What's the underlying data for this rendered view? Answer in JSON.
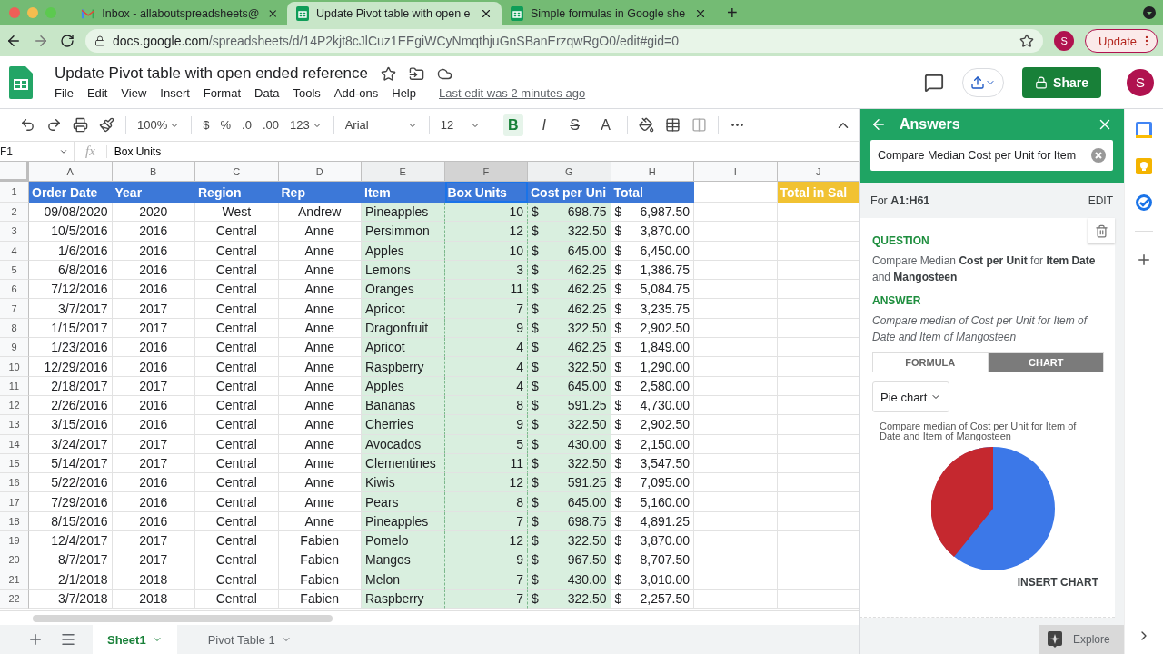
{
  "browser": {
    "tabs": [
      {
        "title": "Inbox - allaboutspreadsheets@",
        "kind": "mail",
        "selected": false
      },
      {
        "title": "Update Pivot table with open e",
        "kind": "sheets",
        "selected": true
      },
      {
        "title": "Simple formulas in Google she",
        "kind": "sheets",
        "selected": false
      }
    ],
    "new_tab": "+",
    "url_domain": "docs.google.com",
    "url_path": "/spreadsheets/d/14P2kjt8cJlCuz1EEgiWCyNmqthjuGnSBanErzqwRgO0/edit#gid=0",
    "profile": "S",
    "update_button": "Update"
  },
  "document": {
    "title": "Update Pivot table with open ended reference",
    "menu": [
      "File",
      "Edit",
      "View",
      "Insert",
      "Format",
      "Data",
      "Tools",
      "Add-ons",
      "Help"
    ],
    "last_edit": "Last edit was 2 minutes ago",
    "share": "Share",
    "avatar": "S"
  },
  "toolbar": {
    "zoom": "100%",
    "format_buttons": [
      "$",
      "%",
      ".0",
      ".00",
      "123"
    ],
    "font": "Arial",
    "font_size": "12",
    "style_buttons": [
      {
        "label": "B",
        "kind": "bold",
        "selected": true
      },
      {
        "label": "I",
        "kind": "italic",
        "selected": false
      },
      {
        "label": "S",
        "kind": "strike",
        "selected": false
      },
      {
        "label": "A",
        "kind": "color",
        "selected": false
      }
    ]
  },
  "formula_bar": {
    "cell": "F1",
    "fx": "fx",
    "value": "Box Units"
  },
  "sheet": {
    "columns": [
      {
        "label": "A",
        "selected": false,
        "highlighted": false
      },
      {
        "label": "B",
        "selected": false,
        "highlighted": false
      },
      {
        "label": "C",
        "selected": false,
        "highlighted": false
      },
      {
        "label": "D",
        "selected": false,
        "highlighted": false
      },
      {
        "label": "E",
        "selected": false,
        "highlighted": true
      },
      {
        "label": "F",
        "selected": true,
        "highlighted": true
      },
      {
        "label": "G",
        "selected": false,
        "highlighted": true
      },
      {
        "label": "H",
        "selected": false,
        "highlighted": false
      },
      {
        "label": "I",
        "selected": false,
        "highlighted": false
      },
      {
        "label": "J",
        "selected": false,
        "highlighted": false
      }
    ],
    "header_row": {
      "number": "1",
      "cells": [
        {
          "kind": "header",
          "text": "Order Date"
        },
        {
          "kind": "header",
          "text": "Year"
        },
        {
          "kind": "header",
          "text": "Region"
        },
        {
          "kind": "header",
          "text": "Rep"
        },
        {
          "kind": "header",
          "text": "Item"
        },
        {
          "kind": "header",
          "text": "Box Units"
        },
        {
          "kind": "header",
          "text": "Cost per Uni"
        },
        {
          "kind": "header",
          "text": "Total"
        },
        {
          "kind": "blank"
        },
        {
          "kind": "accent",
          "text": "Total in Sal"
        }
      ]
    },
    "rows": [
      {
        "number": "2",
        "date": "09/08/2020",
        "year": "2020",
        "region": "West",
        "rep": "Andrew",
        "item": "Pineapples",
        "units": "10",
        "cost": [
          "$",
          "698.75"
        ],
        "total": [
          "$",
          "6,987.50"
        ]
      },
      {
        "number": "3",
        "date": "10/5/2016",
        "year": "2016",
        "region": "Central",
        "rep": "Anne",
        "item": "Persimmon",
        "units": "12",
        "cost": [
          "$",
          "322.50"
        ],
        "total": [
          "$",
          "3,870.00"
        ]
      },
      {
        "number": "4",
        "date": "1/6/2016",
        "year": "2016",
        "region": "Central",
        "rep": "Anne",
        "item": "Apples",
        "units": "10",
        "cost": [
          "$",
          "645.00"
        ],
        "total": [
          "$",
          "6,450.00"
        ]
      },
      {
        "number": "5",
        "date": "6/8/2016",
        "year": "2016",
        "region": "Central",
        "rep": "Anne",
        "item": "Lemons",
        "units": "3",
        "cost": [
          "$",
          "462.25"
        ],
        "total": [
          "$",
          "1,386.75"
        ]
      },
      {
        "number": "6",
        "date": "7/12/2016",
        "year": "2016",
        "region": "Central",
        "rep": "Anne",
        "item": "Oranges",
        "units": "11",
        "cost": [
          "$",
          "462.25"
        ],
        "total": [
          "$",
          "5,084.75"
        ]
      },
      {
        "number": "7",
        "date": "3/7/2017",
        "year": "2017",
        "region": "Central",
        "rep": "Anne",
        "item": "Apricot",
        "units": "7",
        "cost": [
          "$",
          "462.25"
        ],
        "total": [
          "$",
          "3,235.75"
        ]
      },
      {
        "number": "8",
        "date": "1/15/2017",
        "year": "2017",
        "region": "Central",
        "rep": "Anne",
        "item": "Dragonfruit",
        "units": "9",
        "cost": [
          "$",
          "322.50"
        ],
        "total": [
          "$",
          "2,902.50"
        ]
      },
      {
        "number": "9",
        "date": "1/23/2016",
        "year": "2016",
        "region": "Central",
        "rep": "Anne",
        "item": "Apricot",
        "units": "4",
        "cost": [
          "$",
          "462.25"
        ],
        "total": [
          "$",
          "1,849.00"
        ]
      },
      {
        "number": "10",
        "date": "12/29/2016",
        "year": "2016",
        "region": "Central",
        "rep": "Anne",
        "item": "Raspberry",
        "units": "4",
        "cost": [
          "$",
          "322.50"
        ],
        "total": [
          "$",
          "1,290.00"
        ]
      },
      {
        "number": "11",
        "date": "2/18/2017",
        "year": "2017",
        "region": "Central",
        "rep": "Anne",
        "item": "Apples",
        "units": "4",
        "cost": [
          "$",
          "645.00"
        ],
        "total": [
          "$",
          "2,580.00"
        ]
      },
      {
        "number": "12",
        "date": "2/26/2016",
        "year": "2016",
        "region": "Central",
        "rep": "Anne",
        "item": "Bananas",
        "units": "8",
        "cost": [
          "$",
          "591.25"
        ],
        "total": [
          "$",
          "4,730.00"
        ]
      },
      {
        "number": "13",
        "date": "3/15/2016",
        "year": "2016",
        "region": "Central",
        "rep": "Anne",
        "item": "Cherries",
        "units": "9",
        "cost": [
          "$",
          "322.50"
        ],
        "total": [
          "$",
          "2,902.50"
        ]
      },
      {
        "number": "14",
        "date": "3/24/2017",
        "year": "2017",
        "region": "Central",
        "rep": "Anne",
        "item": "Avocados",
        "units": "5",
        "cost": [
          "$",
          "430.00"
        ],
        "total": [
          "$",
          "2,150.00"
        ]
      },
      {
        "number": "15",
        "date": "5/14/2017",
        "year": "2017",
        "region": "Central",
        "rep": "Anne",
        "item": "Clementines",
        "units": "11",
        "cost": [
          "$",
          "322.50"
        ],
        "total": [
          "$",
          "3,547.50"
        ]
      },
      {
        "number": "16",
        "date": "5/22/2016",
        "year": "2016",
        "region": "Central",
        "rep": "Anne",
        "item": "Kiwis",
        "units": "12",
        "cost": [
          "$",
          "591.25"
        ],
        "total": [
          "$",
          "7,095.00"
        ]
      },
      {
        "number": "17",
        "date": "7/29/2016",
        "year": "2016",
        "region": "Central",
        "rep": "Anne",
        "item": "Pears",
        "units": "8",
        "cost": [
          "$",
          "645.00"
        ],
        "total": [
          "$",
          "5,160.00"
        ]
      },
      {
        "number": "18",
        "date": "8/15/2016",
        "year": "2016",
        "region": "Central",
        "rep": "Anne",
        "item": "Pineapples",
        "units": "7",
        "cost": [
          "$",
          "698.75"
        ],
        "total": [
          "$",
          "4,891.25"
        ]
      },
      {
        "number": "19",
        "date": "12/4/2017",
        "year": "2017",
        "region": "Central",
        "rep": "Fabien",
        "item": "Pomelo",
        "units": "12",
        "cost": [
          "$",
          "322.50"
        ],
        "total": [
          "$",
          "3,870.00"
        ]
      },
      {
        "number": "20",
        "date": "8/7/2017",
        "year": "2017",
        "region": "Central",
        "rep": "Fabien",
        "item": "Mangos",
        "units": "9",
        "cost": [
          "$",
          "967.50"
        ],
        "total": [
          "$",
          "8,707.50"
        ]
      },
      {
        "number": "21",
        "date": "2/1/2018",
        "year": "2018",
        "region": "Central",
        "rep": "Fabien",
        "item": "Melon",
        "units": "7",
        "cost": [
          "$",
          "430.00"
        ],
        "total": [
          "$",
          "3,010.00"
        ]
      },
      {
        "number": "22",
        "date": "3/7/2018",
        "year": "2018",
        "region": "Central",
        "rep": "Fabien",
        "item": "Raspberry",
        "units": "7",
        "cost": [
          "$",
          "322.50"
        ],
        "total": [
          "$",
          "2,257.50"
        ]
      }
    ],
    "sheet_tabs": [
      {
        "label": "Sheet1",
        "selected": true
      },
      {
        "label": "Pivot Table 1",
        "selected": false
      }
    ]
  },
  "answers_panel": {
    "title": "Answers",
    "query": "Compare Median Cost per Unit for Item",
    "range": "For **A1:H61**",
    "edit": "EDIT",
    "question_label": "QUESTION",
    "question": "Compare Median **Cost per Unit** for **Item Date** and **Mangosteen**",
    "answer_label": "ANSWER",
    "answer": "Compare median of Cost per Unit for Item of Date and Item of Mangosteen",
    "tabs": [
      {
        "label": "FORMULA",
        "selected": false
      },
      {
        "label": "CHART",
        "selected": true
      }
    ],
    "chart_type": "Pie chart",
    "chart_title": "Compare median of Cost per Unit for Item of Date and Item of Mangosteen",
    "insert": "INSERT CHART",
    "explore": "Explore"
  }
}
